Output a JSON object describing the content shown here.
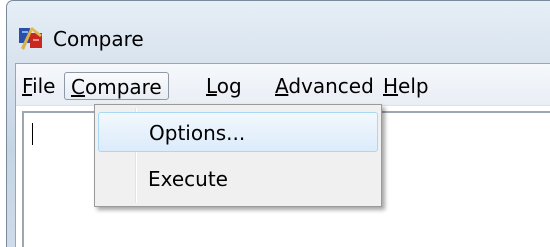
{
  "window": {
    "title": "Compare",
    "icon": "compare-app-icon"
  },
  "menubar": {
    "items": [
      {
        "label": "File",
        "mnemonic": "F",
        "rest": "ile"
      },
      {
        "label": "Compare",
        "mnemonic": "C",
        "rest": "ompare"
      },
      {
        "label": "Log",
        "mnemonic": "L",
        "rest": "og"
      },
      {
        "label": "Advanced",
        "mnemonic": "A",
        "rest": "dvanced"
      },
      {
        "label": "Help",
        "mnemonic": "H",
        "rest": "elp"
      }
    ],
    "active": "Compare"
  },
  "dropdown": {
    "items": [
      {
        "label": "Options...",
        "highlighted": true
      },
      {
        "label": "Execute",
        "highlighted": false
      }
    ]
  },
  "colors": {
    "highlight_border": "#a8d8f4",
    "menu_background": "#f0f0f0",
    "title_gradient": "#d3dfeb"
  }
}
